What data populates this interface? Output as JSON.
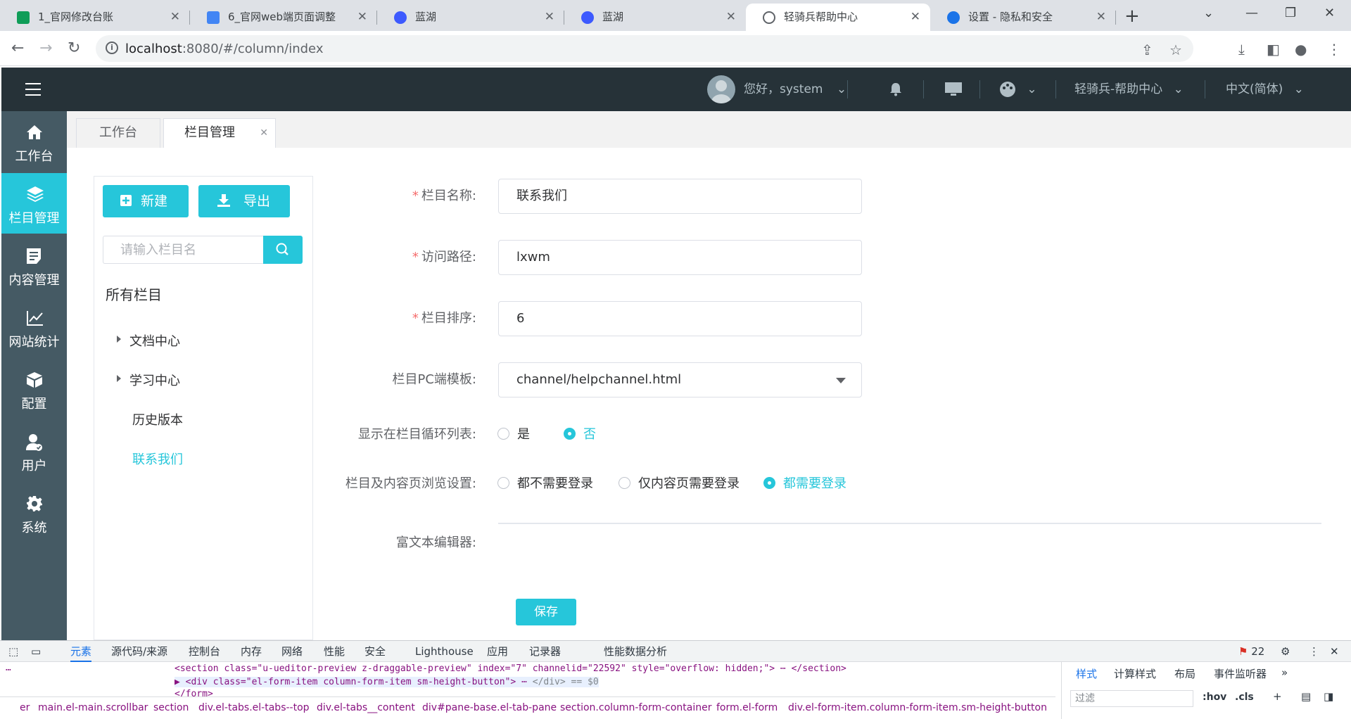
{
  "browser": {
    "tabs": [
      {
        "title": "1_官网修改台账",
        "icon": "sheets-icon",
        "color": "#0f9d58"
      },
      {
        "title": "6_官网web端页面调整",
        "icon": "docs-icon",
        "color": "#4285f4"
      },
      {
        "title": "蓝湖",
        "icon": "lanhu-icon",
        "color": "#3d5afe"
      },
      {
        "title": "蓝湖",
        "icon": "lanhu-icon",
        "color": "#3d5afe"
      },
      {
        "title": "轻骑兵帮助中心",
        "icon": "globe-icon",
        "color": "#5f6368"
      },
      {
        "title": "设置 - 隐私和安全",
        "icon": "gear-icon",
        "color": "#1a73e8"
      }
    ],
    "url_host": "localhost",
    "url_rest": ":8080/#/column/index"
  },
  "header": {
    "greeting": "您好，system",
    "site_name": "轻骑兵-帮助中心",
    "language": "中文(简体)"
  },
  "sidebar": {
    "items": [
      {
        "label": "工作台",
        "icon": "home-icon"
      },
      {
        "label": "栏目管理",
        "icon": "layers-icon"
      },
      {
        "label": "内容管理",
        "icon": "document-icon"
      },
      {
        "label": "网站统计",
        "icon": "chart-icon"
      },
      {
        "label": "配置",
        "icon": "cube-icon"
      },
      {
        "label": "用户",
        "icon": "user-icon"
      },
      {
        "label": "系统",
        "icon": "gear-icon"
      }
    ],
    "active": 1
  },
  "page_tabs": [
    {
      "label": "工作台"
    },
    {
      "label": "栏目管理",
      "closable": true
    }
  ],
  "tree_panel": {
    "new_label": "新建",
    "export_label": "导出",
    "search_placeholder": "请输入栏目名",
    "root_label": "所有栏目",
    "nodes": [
      {
        "label": "文档中心",
        "expandable": true
      },
      {
        "label": "学习中心",
        "expandable": true
      },
      {
        "label": "历史版本",
        "expandable": false
      },
      {
        "label": "联系我们",
        "expandable": false,
        "selected": true
      }
    ]
  },
  "form": {
    "name_label": "栏目名称:",
    "name_value": "联系我们",
    "path_label": "访问路径:",
    "path_value": "lxwm",
    "sort_label": "栏目排序:",
    "sort_value": "6",
    "template_label": "栏目PC端模板:",
    "template_value": "channel/helpchannel.html",
    "loop_label": "显示在栏目循环列表:",
    "loop_options": [
      "是",
      "否"
    ],
    "loop_selected": "否",
    "browse_label": "栏目及内容页浏览设置:",
    "browse_options": [
      "都不需要登录",
      "仅内容页需要登录",
      "都需要登录"
    ],
    "browse_selected": "都需要登录",
    "editor_label": "富文本编辑器:",
    "save_label": "保存"
  },
  "devtools": {
    "tabs": [
      "元素",
      "源代码/来源",
      "控制台",
      "内存",
      "网络",
      "性能",
      "安全",
      "Lighthouse",
      "应用",
      "记录器",
      "性能数据分析"
    ],
    "issue_count": "22",
    "code_line1": "<section class=\"u-ueditor-preview z-draggable-preview\" index=\"7\" channelid=\"22592\" style=\"overflow: hidden;\">",
    "code_line1_end": "</section>",
    "code_line2": "<div class=\"el-form-item column-form-item sm-height-button\">",
    "code_line2_end": "</div> == $0",
    "code_line3": "</form>",
    "crumbs": [
      "er",
      "main.el-main.scrollbar",
      "section",
      "div.el-tabs.el-tabs--top",
      "div.el-tabs__content",
      "div#pane-base.el-tab-pane",
      "section.column-form-container",
      "form.el-form",
      "div.el-form-item.column-form-item.sm-height-button"
    ],
    "side_tabs": [
      "样式",
      "计算样式",
      "布局",
      "事件监听器"
    ],
    "filter_placeholder": "过滤",
    "hov": ":hov",
    "cls": ".cls"
  },
  "colors": {
    "accent": "#26c6da",
    "header_bg": "#263238",
    "sidebar_bg": "#455a64"
  }
}
